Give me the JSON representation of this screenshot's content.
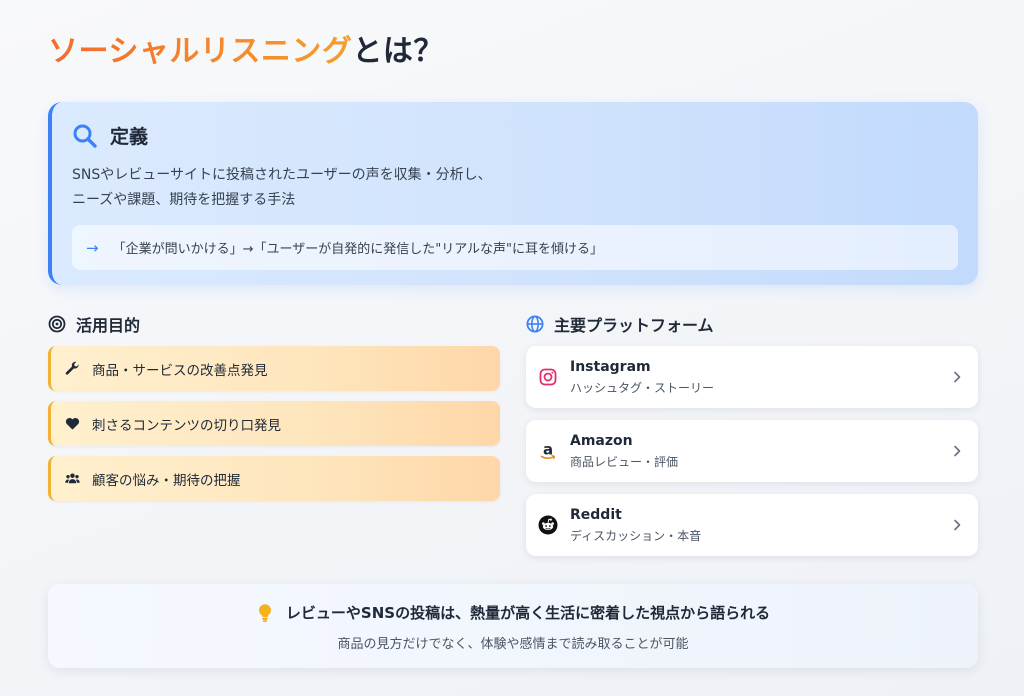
{
  "title": {
    "accent": "ソーシャルリスニング",
    "rest": "とは？"
  },
  "definition": {
    "heading": "定義",
    "body_line1": "SNSやレビューサイトに投稿されたユーザーの声を収集・分析し、",
    "body_line2": "ニーズや課題、期待を把握する手法",
    "note": "「企業が問いかける」→「ユーザーが自発的に発信した\"リアルな声\"に耳を傾ける」"
  },
  "purpose": {
    "heading": "活用目的",
    "items": [
      {
        "label": "商品・サービスの改善点発見",
        "icon": "wrench-icon"
      },
      {
        "label": "刺さるコンテンツの切り口発見",
        "icon": "heart-icon"
      },
      {
        "label": "顧客の悩み・期待の把握",
        "icon": "users-icon"
      }
    ]
  },
  "platforms": {
    "heading": "主要プラットフォーム",
    "items": [
      {
        "name": "Instagram",
        "desc": "ハッシュタグ・ストーリー",
        "icon": "instagram-icon",
        "color": "#e1306c"
      },
      {
        "name": "Amazon",
        "desc": "商品レビュー・評価",
        "icon": "amazon-icon",
        "color": "#e7901a"
      },
      {
        "name": "Reddit",
        "desc": "ディスカッション・本音",
        "icon": "reddit-icon",
        "color": "#111111"
      }
    ]
  },
  "insight": {
    "headline": "レビューやSNSの投稿は、熱量が高く生活に密着した視点から語られる",
    "sub": "商品の見方だけでなく、体験や感情まで読み取ることが可能"
  },
  "colors": {
    "accent_blue": "#3b82f6",
    "accent_orange": "#f56a2c",
    "accent_amber": "#f2b233"
  }
}
